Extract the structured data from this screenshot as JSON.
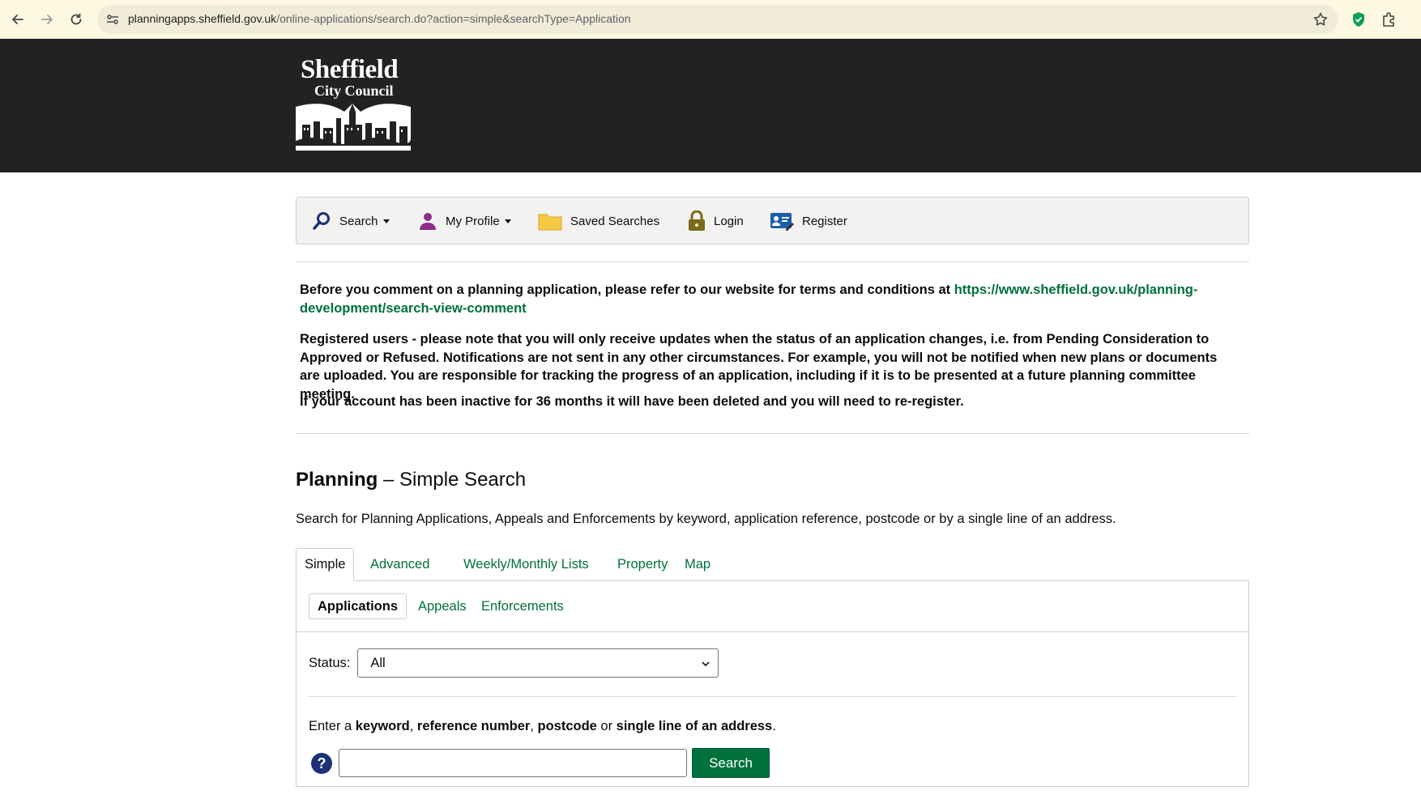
{
  "browser": {
    "url_host": "planningapps.sheffield.gov.uk",
    "url_path": "/online-applications/search.do?action=simple&searchType=Application",
    "icons": [
      "back-icon",
      "forward-icon",
      "reload-icon",
      "site-settings-icon",
      "bookmark-star-icon",
      "shield-extension-icon",
      "puzzle-extension-icon"
    ]
  },
  "header": {
    "logo_line1": "Sheffield",
    "logo_line2": "City Council",
    "background": "#222222"
  },
  "menu": {
    "search": "Search",
    "my_profile": "My Profile",
    "saved_searches": "Saved Searches",
    "login": "Login",
    "register": "Register"
  },
  "notice": {
    "p1_text": "Before you comment on a planning application, please refer to our website for terms and conditions at ",
    "p1_link": "https://www.sheffield.gov.uk/planning-development/search-view-comment",
    "p2": "Registered users - please note that you will only receive updates when the status of an application changes, i.e. from Pending Consideration to Approved or Refused. Notifications are not sent in any other circumstances.  For example, you will not be notified when new plans or documents are uploaded. You are responsible for tracking the progress of an application, including if it is to be presented at a future planning committee meeting.",
    "p3": "If your account has been inactive for 36 months it will have been deleted and you will need to re-register."
  },
  "page": {
    "title_strong": "Planning",
    "title_rest": " – Simple Search",
    "description": "Search for Planning Applications, Appeals and Enforcements by keyword, application reference, postcode or by a single line of an address."
  },
  "tabs": [
    "Simple",
    "Advanced",
    "Weekly/Monthly Lists",
    "Property",
    "Map"
  ],
  "subtabs": [
    "Applications",
    "Appeals",
    "Enforcements"
  ],
  "form": {
    "status_label": "Status:",
    "status_value": "All",
    "instr_1": "Enter a ",
    "instr_keyword": "keyword",
    "instr_2": ", ",
    "instr_ref": "reference number",
    "instr_3": ", ",
    "instr_postcode": "postcode",
    "instr_4": " or ",
    "instr_line": "single line of an address",
    "instr_5": ".",
    "help": "?",
    "search_value": "",
    "search_button": "Search"
  },
  "colors": {
    "link_green": "#00703c",
    "button_green": "#00703c",
    "help_blue": "#1d3078",
    "menubar_bg": "#f3f2f1"
  }
}
